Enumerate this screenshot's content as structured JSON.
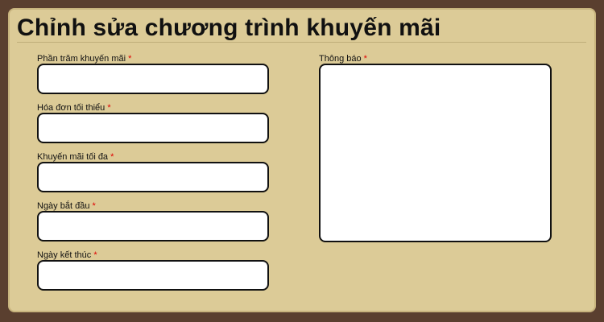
{
  "page": {
    "title": "Chỉnh sửa chương trình khuyến mãi"
  },
  "form": {
    "required_marker": "*",
    "fields": {
      "discount_percent": {
        "label": "Phần trăm khuyến mãi",
        "value": ""
      },
      "min_invoice": {
        "label": "Hóa đơn tối thiểu",
        "value": ""
      },
      "max_discount": {
        "label": "Khuyến mãi tối đa",
        "value": ""
      },
      "start_date": {
        "label": "Ngày bắt đầu",
        "value": ""
      },
      "end_date": {
        "label": "Ngày kết thúc",
        "value": ""
      },
      "notice": {
        "label": "Thông báo",
        "value": ""
      }
    }
  },
  "colors": {
    "background": "#5a3f2f",
    "panel": "#dccb97",
    "required": "#e00000"
  }
}
